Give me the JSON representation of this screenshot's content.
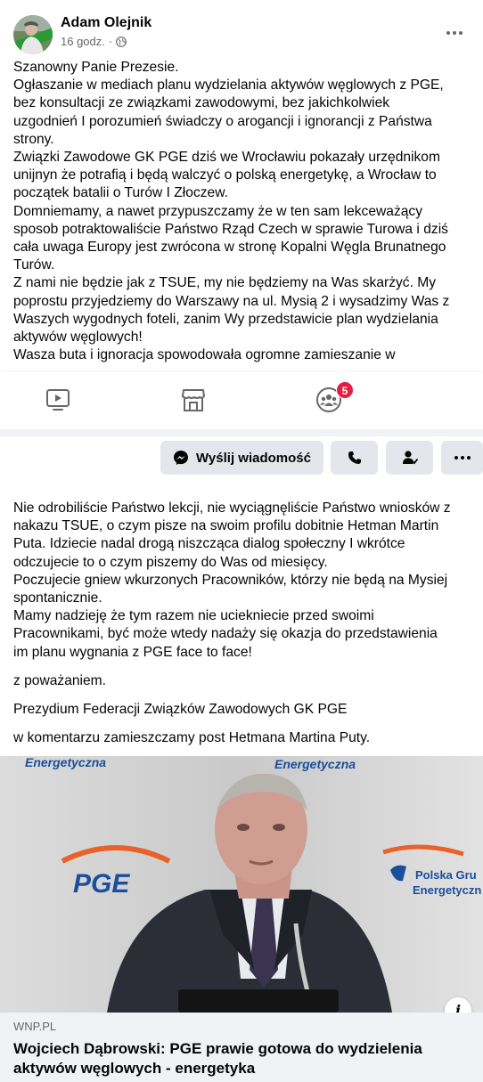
{
  "post": {
    "author": "Adam Olejnik",
    "time": "16 godz.",
    "separator": "·",
    "privacy_icon": "globe-icon",
    "body_part1": [
      "Szanowny Panie Prezesie.",
      "Ogłaszanie w mediach planu wydzielania aktywów węglowych z PGE,",
      "bez konsultacji ze związkami zawodowymi,  bez jakichkolwiek",
      "uzgodnień I porozumień świadczy o arogancji i ignorancji z Państwa",
      "strony.",
      "Związki Zawodowe GK PGE dziś we Wrocławiu pokazały urzędnikom",
      "unijnyn że potrafią i będą walczyć o polską energetykę,  a Wrocław to",
      "początek batalii o Turów I Złoczew.",
      "Domniemamy,  a nawet przypuszczamy że w ten sam lekceważący",
      "sposob potraktowaliście Państwo Rząd Czech w sprawie Turowa i dziś",
      "cała uwaga Europy jest zwrócona w stronę Kopalni Węgla Brunatnego",
      "Turów.",
      "Z nami nie będzie jak z TSUE,  my nie będziemy na Was skarżyć. My",
      "poprostu przyjedziemy do Warszawy na ul. Mysią 2 i wysadzimy Was z",
      "Waszych wygodnych foteli,  zanim Wy przedstawicie plan wydzielania",
      "aktywów węglowych!",
      "Wasza buta i ignoracja spowodowała ogromne zamieszanie w"
    ],
    "body_part2": [
      "Nie odrobiliście Państwo lekcji, nie wyciągnęliście Państwo wniosków z",
      "nakazu TSUE, o czym pisze na swoim profilu dobitnie Hetman Martin",
      "Puta. Idziecie nadal drogą niszcząca dialog społeczny I wkrótce",
      "odczujecie to o czym piszemy do Was od miesięcy.",
      "Poczujecie gniew wkurzonych Pracowników,  którzy nie będą na Mysiej",
      "spontanicznie.",
      "Mamy nadzieję że tym razem nie uciekniecie przed swoimi",
      "Pracownikami,  być może wtedy nadaży się okazja do przedstawienia",
      "im planu wygnania z PGE face to face!"
    ],
    "closing": "z poważaniem.",
    "signature": "Prezydium Federacji Związków Zawodowych GK PGE",
    "comment_note": "w komentarzu zamieszczamy post Hetmana Martina Puty."
  },
  "bottom_nav": {
    "items": [
      {
        "icon": "video-icon"
      },
      {
        "icon": "marketplace-icon"
      },
      {
        "icon": "groups-icon",
        "badge": "5"
      }
    ],
    "badge_color": "#e41e3f"
  },
  "actions": {
    "message_label": "Wyślij wiadomość",
    "message_icon": "messenger-icon",
    "call_icon": "phone-icon",
    "friend_icon": "friends-icon",
    "more_icon": "more-icon"
  },
  "link_preview": {
    "image_text": {
      "brand": "PGE",
      "backdrop_left": "Energetyczna",
      "backdrop_top": "Energetyczna",
      "backdrop_right_line1": "Polska Gru",
      "backdrop_right_line2": "Energetyczn"
    },
    "domain": "WNP.PL",
    "title_line1": "Wojciech Dąbrowski: PGE prawie gotowa do wydzielenia",
    "title_line2": "aktywów węglowych - energetyka",
    "info_label": "i"
  },
  "colors": {
    "text": "#050505",
    "secondary": "#65676b",
    "button_bg": "#e4e6eb",
    "divider": "#f0f2f5"
  }
}
